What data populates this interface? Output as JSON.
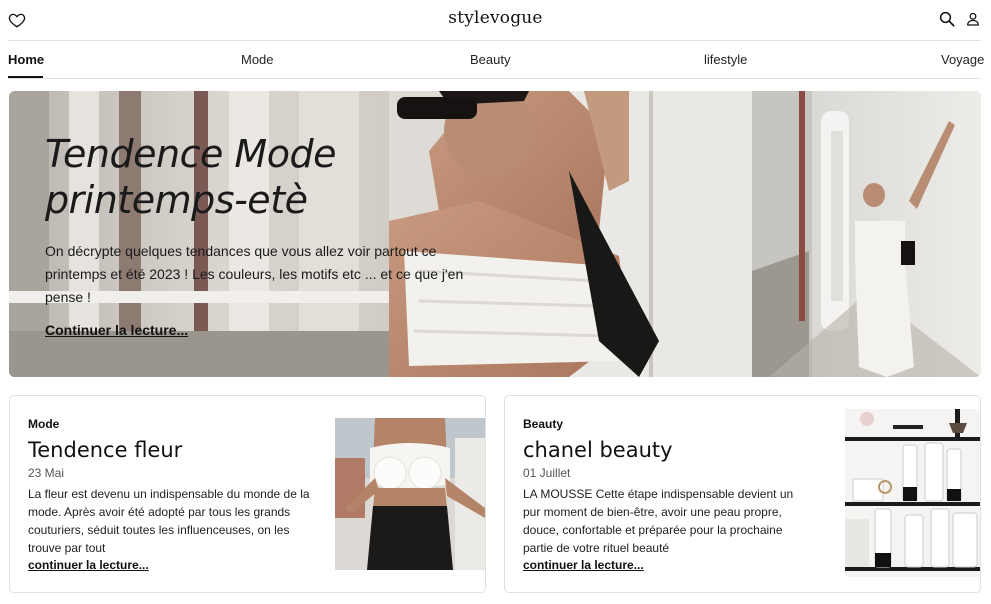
{
  "header": {
    "brand": "stylevogue",
    "icons": [
      "heart-icon",
      "search-icon",
      "user-icon"
    ]
  },
  "nav": {
    "items": [
      {
        "label": "Home",
        "active": true
      },
      {
        "label": "Mode"
      },
      {
        "label": "Beauty"
      },
      {
        "label": "lifestyle"
      },
      {
        "label": "Voyage"
      }
    ]
  },
  "hero": {
    "title_line1": "Tendence Mode",
    "title_line2": "printemps-etè",
    "excerpt": "On décrypte quelques tendances que vous allez voir partout ce printemps et été 2023 ! Les couleurs, les motifs etc ... et ce que j'en pense !",
    "more_label": "Continuer la lecture..."
  },
  "cards": [
    {
      "category": "Mode",
      "title": "Tendence fleur",
      "date": "23 Mai",
      "text": "La fleur est devenu un indispensable du monde de la mode. Après avoir été adopté par tous les grands couturiers, séduit toutes les influenceuses, on les trouve par tout",
      "more_label": "continuer la lecture..."
    },
    {
      "category": "Beauty",
      "title": "chanel beauty",
      "date": "01 Juillet",
      "text": "LA MOUSSE Cette étape indispensable devient un pur moment de bien-être, avoir une peau propre, douce, confortable et préparée pour la prochaine partie de votre rituel beauté",
      "more_label": "continuer la lecture..."
    }
  ],
  "colors": {
    "text": "#111111",
    "divider": "#e2e2e2",
    "wall": "#e4e1dc"
  }
}
